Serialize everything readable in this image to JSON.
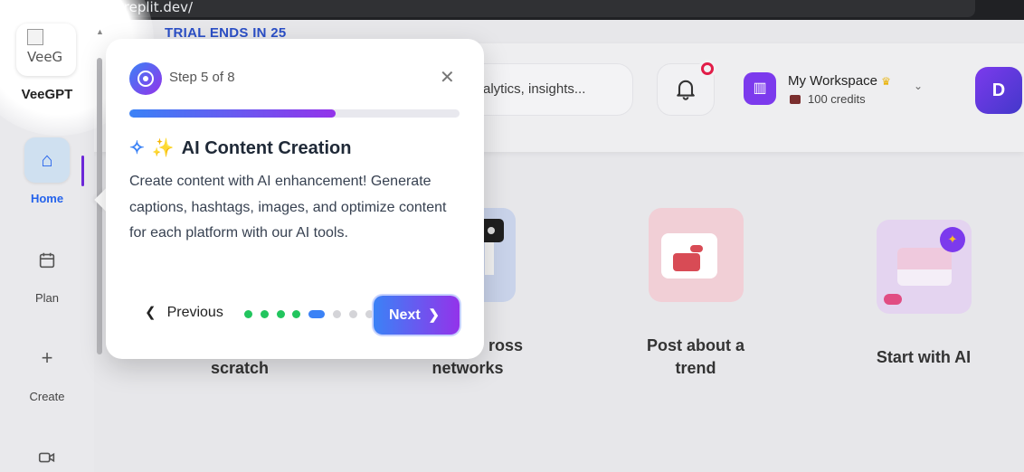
{
  "browser": {
    "back_icon": "←",
    "forward_icon": "→",
    "reload_icon": "↻",
    "url": ".replit.dev/"
  },
  "sidebar": {
    "logo_alt": "VeeG",
    "brand": "VeeGPT",
    "items": [
      {
        "label": "Home",
        "icon": "home-icon",
        "active": true
      },
      {
        "label": "Plan",
        "icon": "calendar-icon"
      },
      {
        "label": "Create",
        "icon": "plus-icon"
      },
      {
        "label": "",
        "icon": "video-icon"
      }
    ]
  },
  "header": {
    "trial_banner": "TRIAL ENDS IN 25",
    "search_placeholder": "alytics, insights...",
    "workspace": {
      "name": "My Workspace",
      "credits": "100 credits"
    },
    "avatar_initial": "D"
  },
  "cards": [
    {
      "title_line1": "scratch",
      "title_line2": ""
    },
    {
      "title_line1": "ross",
      "title_line2": "networks"
    },
    {
      "title_line1": "Post about a",
      "title_line2": "trend"
    },
    {
      "title_line1": "Start with AI",
      "title_line2": ""
    }
  ],
  "tour": {
    "step_label": "Step 5 of 8",
    "progress": 0.625,
    "title": "AI Content Creation",
    "title_emoji": "✨",
    "body": "Create content with AI enhancement! Generate captions, hashtags, images, and optimize content for each platform with our AI tools.",
    "previous_label": "Previous",
    "next_label": "Next",
    "total_steps": 8,
    "current_step": 5
  },
  "colors": {
    "accent_blue": "#3b82f6",
    "accent_purple": "#9333ea",
    "step_done": "#22c55e",
    "step_todo": "#d4d4d8",
    "trial_text": "#2b4fc7"
  }
}
